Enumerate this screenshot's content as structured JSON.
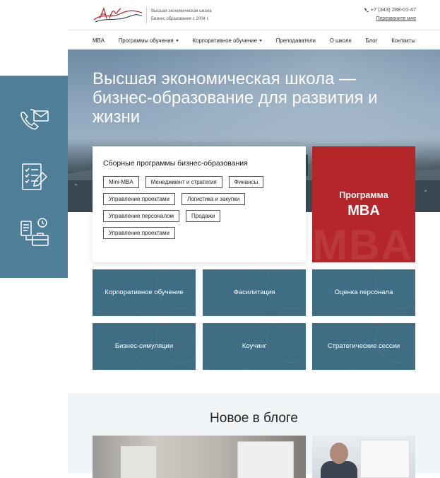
{
  "header": {
    "tagline_line1": "Высшая экономическая школа",
    "tagline_line2": "Бизнес образование с 2004 г.",
    "phone": "+7 (343) 288-01-47",
    "callback": "Перезвоните мне"
  },
  "nav": {
    "items": [
      {
        "label": "MBA"
      },
      {
        "label": "Программы обучения"
      },
      {
        "label": "Корпоративное обучение"
      },
      {
        "label": "Преподаватели"
      },
      {
        "label": "О школе"
      },
      {
        "label": "Блог"
      },
      {
        "label": "Контакты"
      }
    ]
  },
  "hero": {
    "title": "Высшая экономическая школа — бизнес-образование для развития и жизни"
  },
  "programs": {
    "heading": "Сборные программы бизнес-образования",
    "tags": [
      "Mini-MBA",
      "Менеджмент и стратегия",
      "Финансы",
      "Управление проектами",
      "Логистика и закупки",
      "Управление персоналом",
      "Продажи",
      "Управление проектами"
    ]
  },
  "mba": {
    "line1": "Программа",
    "line2": "MBA",
    "watermark": "MBA"
  },
  "tiles": [
    {
      "label": "Корпоративное обучение"
    },
    {
      "label": "Фасилитация"
    },
    {
      "label": "Оценка персонала"
    },
    {
      "label": "Бизнес-симуляции"
    },
    {
      "label": "Коучинг"
    },
    {
      "label": "Стратегические сессии"
    }
  ],
  "blog": {
    "heading": "Новое в блоге"
  },
  "colors": {
    "sidebar": "#4f7e98",
    "tile": "#3f6d84",
    "mba": "#b5262b",
    "blog_bg": "#f2f5f7"
  },
  "icons": {
    "sidebar": [
      "phone-mail-icon",
      "checklist-icon",
      "schedule-briefcase-icon"
    ],
    "phone": "phone-icon"
  }
}
